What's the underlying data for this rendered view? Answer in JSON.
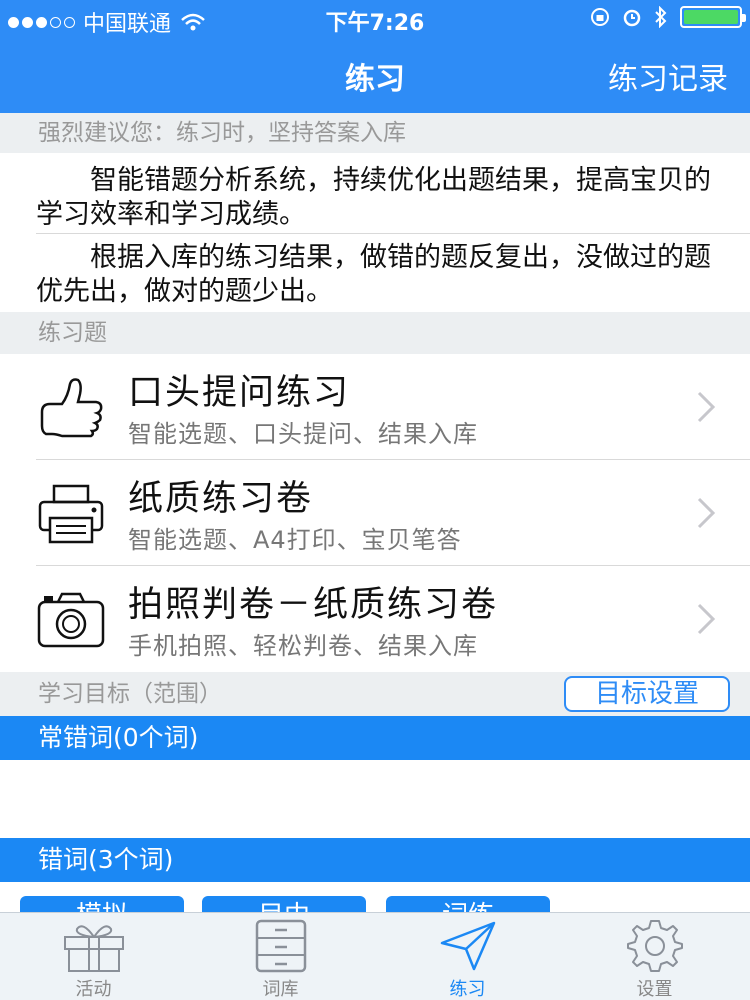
{
  "status_bar": {
    "carrier": "中国联通",
    "time": "下午7:26",
    "signal_filled": 3,
    "signal_total": 5,
    "battery_level": 1.0
  },
  "nav": {
    "title": "练习",
    "right_button": "练习记录"
  },
  "advice": {
    "header": "强烈建议您：练习时，坚持答案入库",
    "para1": "智能错题分析系统，持续优化出题结果，提高宝贝的学习效率和学习成绩。",
    "para2": "根据入库的练习结果，做错的题反复出，没做过的题优先出，做对的题少出。"
  },
  "exercises": {
    "header": "练习题",
    "items": [
      {
        "title": "口头提问练习",
        "subtitle": "智能选题、口头提问、结果入库",
        "icon": "thumbs-up-icon"
      },
      {
        "title": "纸质练习卷",
        "subtitle": "智能选题、A4打印、宝贝笔答",
        "icon": "printer-icon"
      },
      {
        "title": "拍照判卷－纸质练习卷",
        "subtitle": "手机拍照、轻松判卷、结果入库",
        "icon": "camera-icon"
      }
    ]
  },
  "goals": {
    "header": "学习目标（范围）",
    "set_button": "目标设置",
    "common_wrong": "常错词(0个词)",
    "wrong": "错词(3个词)"
  },
  "buttons_partial": [
    "模拟",
    "目中",
    "词练"
  ],
  "tabbar": {
    "items": [
      {
        "label": "活动",
        "icon": "gift-icon"
      },
      {
        "label": "词库",
        "icon": "cabinet-icon"
      },
      {
        "label": "练习",
        "icon": "send-icon",
        "active": true
      },
      {
        "label": "设置",
        "icon": "gear-icon"
      }
    ]
  },
  "colors": {
    "primary": "#2e8cf6",
    "bar_blue": "#1b88f4",
    "section_bg": "#eceff1",
    "battery_green": "#4cd964"
  }
}
